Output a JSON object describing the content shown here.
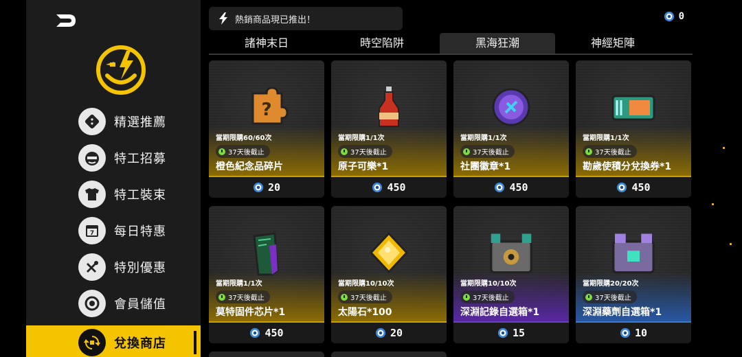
{
  "sidebar": {
    "back_icon": "back-arrow-icon",
    "logo_icon": "smiley-lightning-logo-icon",
    "items": [
      {
        "label": "精選推薦",
        "icon": "dice-icon",
        "active": false
      },
      {
        "label": "特工招募",
        "icon": "agent-face-icon",
        "active": false
      },
      {
        "label": "特工裝束",
        "icon": "shirt-icon",
        "active": false
      },
      {
        "label": "每日特惠",
        "icon": "calendar-icon",
        "active": false
      },
      {
        "label": "特別優惠",
        "icon": "tools-icon",
        "active": false
      },
      {
        "label": "會員儲值",
        "icon": "coin-ring-icon",
        "active": false
      },
      {
        "label": "兌換商店",
        "icon": "exchange-icon",
        "active": true
      }
    ]
  },
  "header": {
    "ticker_icon": "lightning-icon",
    "ticker_text": "熱銷商品現已推出！",
    "currency_icon": "token-icon",
    "currency_amount": "0"
  },
  "tabs": [
    {
      "label": "諸神末日",
      "active": false
    },
    {
      "label": "時空陷阱",
      "active": false
    },
    {
      "label": "黑海狂潮",
      "active": true
    },
    {
      "label": "神經矩陣",
      "active": false
    }
  ],
  "products": [
    {
      "name": "橙色紀念品碎片",
      "limit": "當期限購60/60次",
      "timer": "37天後截止",
      "price": "20",
      "rarity": "gold",
      "icon": "puzzle-piece-icon"
    },
    {
      "name": "原子可樂*1",
      "limit": "當期限購1/1次",
      "timer": "37天後截止",
      "price": "450",
      "rarity": "gold",
      "icon": "cola-bottle-icon"
    },
    {
      "name": "社團徽章*1",
      "limit": "當期限購1/1次",
      "timer": "37天後截止",
      "price": "450",
      "rarity": "gold",
      "icon": "badge-icon"
    },
    {
      "name": "勘歲使積分兌換券*1",
      "limit": "當期限購1/1次",
      "timer": "37天後截止",
      "price": "450",
      "rarity": "gold",
      "icon": "ticket-icon"
    },
    {
      "name": "莫特固件芯片*1",
      "limit": "當期限購1/1次",
      "timer": "37天後截止",
      "price": "450",
      "rarity": "gold",
      "icon": "chip-icon"
    },
    {
      "name": "太陽石*100",
      "limit": "當期限購10/10次",
      "timer": "37天後截止",
      "price": "20",
      "rarity": "gold",
      "icon": "sun-stone-icon"
    },
    {
      "name": "深淵記錄自選箱*1",
      "limit": "當期限購10/10次",
      "timer": "37天後截止",
      "price": "15",
      "rarity": "purple",
      "icon": "treasure-chest-icon"
    },
    {
      "name": "深淵藥劑自選箱*1",
      "limit": "當期限購20/20次",
      "timer": "37天後截止",
      "price": "10",
      "rarity": "blue",
      "icon": "supply-chest-icon"
    }
  ],
  "colors": {
    "accent": "#f5c400",
    "sidebar_bg": "#1c1c1c",
    "gold_rarity": "#c8a000",
    "purple_rarity": "#6a40c0",
    "blue_rarity": "#3a7ad0"
  }
}
